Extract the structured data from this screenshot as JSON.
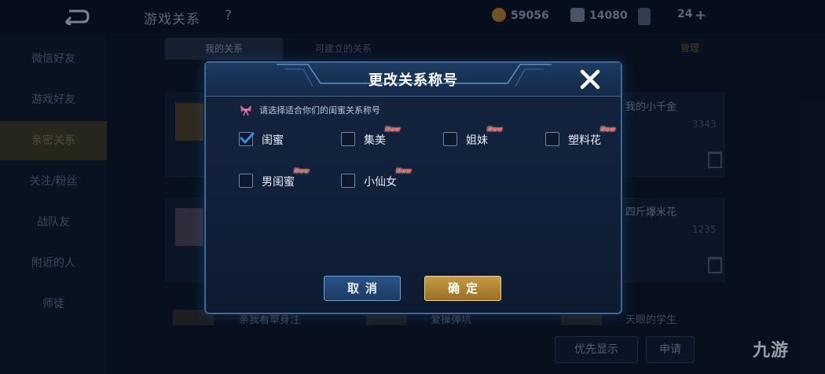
{
  "topbar": {
    "title": "游戏关系",
    "help": "?",
    "coins": "59056",
    "diamonds": "14080",
    "tickets": "24",
    "plus": "+"
  },
  "sidebar": {
    "items": [
      {
        "label": "微信好友"
      },
      {
        "label": "游戏好友"
      },
      {
        "label": "亲密关系"
      },
      {
        "label": "关注/粉丝"
      },
      {
        "label": "战队友"
      },
      {
        "label": "附近的人"
      },
      {
        "label": "师徒"
      }
    ],
    "active_index": 2
  },
  "tabs": [
    {
      "label": "我的关系"
    },
    {
      "label": "可建立的关系"
    }
  ],
  "manage_label": "管理",
  "cards": [
    {
      "name": "我的小千金",
      "score": "3343"
    },
    {
      "name": "四斤爆米花",
      "score": "1235"
    }
  ],
  "recruits": [
    {
      "text": "亲我看草身注"
    },
    {
      "text": "爱操弹坑"
    },
    {
      "text": "天眼的学生"
    }
  ],
  "bottom": {
    "priority_button": "优先显示",
    "apply_button": "申请"
  },
  "watermark": "九游",
  "dialog": {
    "title": "更改关系称号",
    "hint": "请选择适合你们的闺蜜关系称号",
    "new_badge": "New",
    "options": [
      {
        "label": "闺蜜",
        "checked": true,
        "is_new": false
      },
      {
        "label": "集美",
        "checked": false,
        "is_new": true
      },
      {
        "label": "姐妹",
        "checked": false,
        "is_new": true
      },
      {
        "label": "塑料花",
        "checked": false,
        "is_new": true
      },
      {
        "label": "男闺蜜",
        "checked": false,
        "is_new": true
      },
      {
        "label": "小仙女",
        "checked": false,
        "is_new": true
      }
    ],
    "cancel_label": "取消",
    "confirm_label": "确定"
  },
  "colors": {
    "accent_blue": "#3d6b9e",
    "confirm_gold": "#c49a45",
    "check_blue": "#3a8fe6",
    "new_red": "#ff3b3b"
  }
}
